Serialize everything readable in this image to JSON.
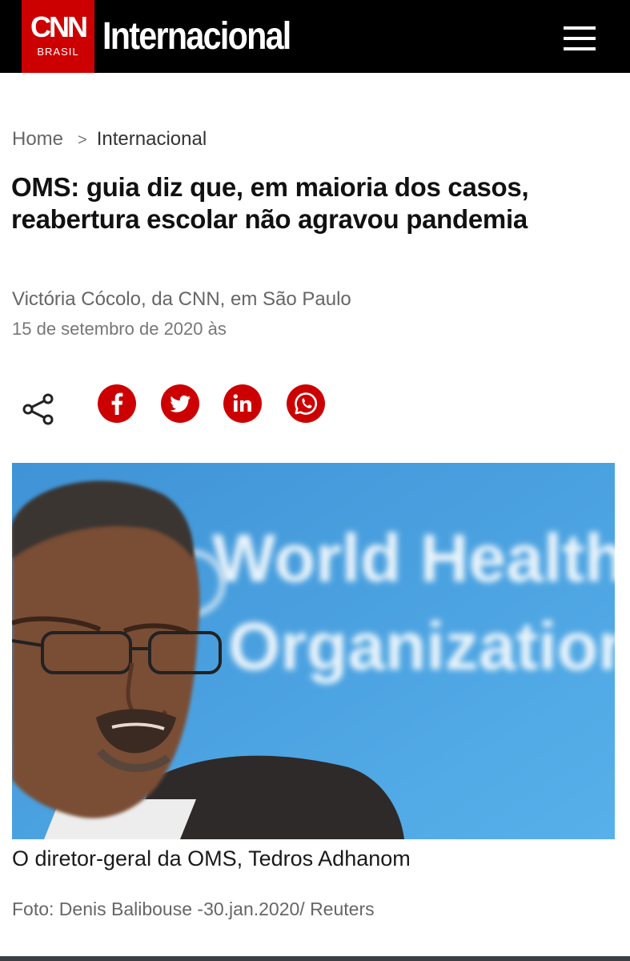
{
  "header": {
    "logo_text": "CNN",
    "logo_subtext": "BRASIL",
    "section_title": "Internacional",
    "menu_icon": "hamburger-menu-icon",
    "brand_color": "#cc0000",
    "bar_color": "#000000"
  },
  "breadcrumb": {
    "home": "Home",
    "separator": ">",
    "current": "Internacional"
  },
  "article": {
    "headline_line1": "OMS: guia diz que, em maioria dos casos,",
    "headline_line2": "reabertura escolar não agravou pandemia",
    "byline": "Victória Cócolo, da CNN, em São Paulo",
    "date": "15 de setembro de 2020 às"
  },
  "share": {
    "share_icon": "share-icon",
    "buttons": [
      {
        "name": "facebook",
        "icon": "facebook-icon"
      },
      {
        "name": "twitter",
        "icon": "twitter-icon"
      },
      {
        "name": "linkedin",
        "icon": "linkedin-icon"
      },
      {
        "name": "whatsapp",
        "icon": "whatsapp-icon"
      }
    ],
    "button_color": "#cc0000"
  },
  "photo": {
    "backdrop_line1": "World Health",
    "backdrop_line2": "Organization",
    "backdrop_color": "#4aa0e0",
    "caption": "O diretor-geral da OMS, Tedros Adhanom",
    "credit": "Foto: Denis Balibouse -30.jan.2020/ Reuters"
  }
}
